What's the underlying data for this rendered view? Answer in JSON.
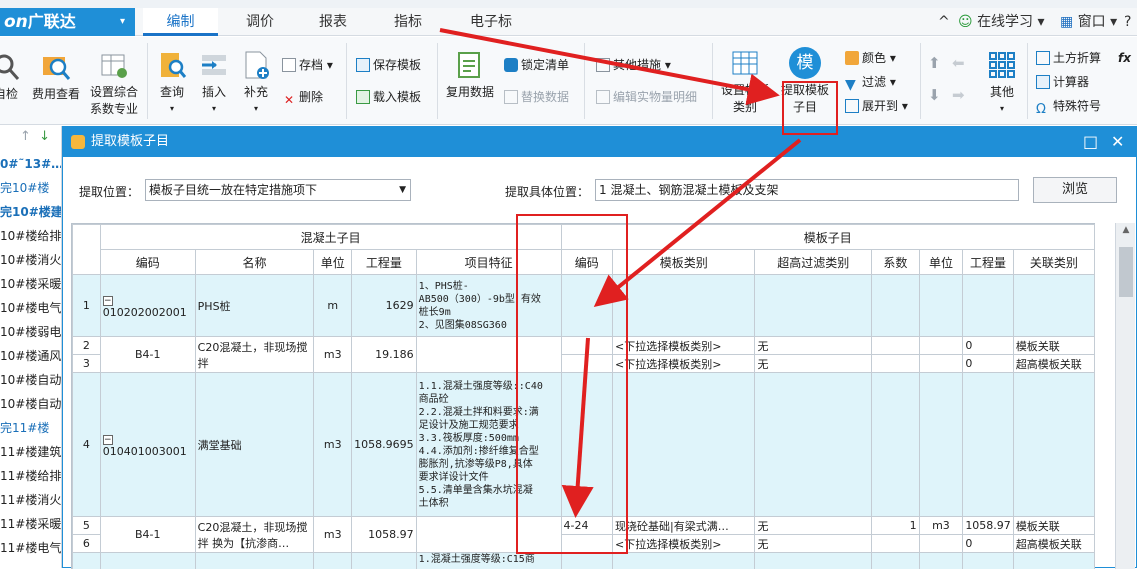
{
  "menu": {
    "logo_main": "on",
    "logo_cn": "广联达",
    "logo_dropdown": "▾",
    "tabs": [
      "编制",
      "调价",
      "报表",
      "指标",
      "电子标"
    ],
    "right": {
      "collapse": "^",
      "online": "在线学习",
      "window": "窗口",
      "help": "?"
    }
  },
  "ribbon": {
    "b_check": "自检",
    "b_fee": "费用查看",
    "b_set_unit": "设置综合",
    "b_set_unit2": "系数专业",
    "b_query": "查询",
    "b_insert": "插入",
    "b_supplement": "补充",
    "s_save": "存档",
    "s_delete": "删除",
    "s_save_tpl": "保存模板",
    "s_load_tpl": "载入模板",
    "b_reuse": "复用数据",
    "s_lock": "锁定清单",
    "s_replace": "替换数据",
    "s_other": "其他措施",
    "s_edit_detail": "编辑实物量明细",
    "b_set_tpl": "设置模板",
    "b_set_tpl2": "类别",
    "b_extract": "提取模板",
    "b_extract2": "子目",
    "extract_icon_char": "模",
    "s_color": "颜色",
    "s_filter": "过滤",
    "s_expand": "展开到",
    "b_other": "其他",
    "s_calc_up": "土方折算",
    "s_calculator": "计算器",
    "s_special": "特殊符号",
    "s_fx": "fx"
  },
  "sidebar": {
    "nav_up": "↑",
    "nav_down": "↓",
    "items": [
      "0#˜13#…",
      "完10#楼",
      "完10#楼建·",
      "10#楼给排",
      "10#楼消火",
      "10#楼采暖",
      "10#楼电气",
      "10#楼弱电",
      "10#楼通风",
      "10#楼自动",
      "10#楼自动",
      "完11#楼",
      "11#楼建筑",
      "11#楼给排",
      "11#楼消火",
      "11#楼采暖",
      "11#楼电气"
    ]
  },
  "dialog": {
    "title": "提取模板子目",
    "maximize": "□",
    "close": "✕",
    "pos_label": "提取位置：",
    "pos_value": "模板子目统一放在特定措施项下",
    "detail_label": "提取具体位置：",
    "detail_value": "1 混凝土、钢筋混凝土模板及支架",
    "browse": "浏览",
    "group_concrete": "混凝土子目",
    "group_template": "模板子目",
    "cols": [
      "编码",
      "名称",
      "单位",
      "工程量",
      "项目特征",
      "编码",
      "模板类别",
      "超高过滤类别",
      "系数",
      "单位",
      "工程量",
      "关联类别"
    ],
    "rows": [
      {
        "no": "1",
        "code": "010202002001",
        "name": "PHS桩",
        "unit": "m",
        "qty": "1629",
        "feat": [
          "1、PHS桩-",
          "AB500（300）-9b型  有效",
          "桩长9m",
          "2、见图集08SG360"
        ]
      },
      {
        "no": "2",
        "tcat": "<下拉选择模板类别>",
        "tfilter": "无",
        "tqty": "0",
        "tlink": "模板关联"
      },
      {
        "no": "3",
        "tcat": "<下拉选择模板类别>",
        "tfilter": "无",
        "tqty": "0",
        "tlink": "超高模板关联"
      },
      {
        "no": "4",
        "code": "010401003001",
        "name": "满堂基础",
        "unit": "m3",
        "qty": "1058.9695",
        "feat": [
          "1.1.混凝土强度等级::C40",
          "商品砼",
          "2.2.混凝土拌和料要求:满",
          "足设计及施工规范要求",
          "3.3.筏板厚度:500mm",
          "4.4.添加剂:掺纤维复合型",
          "膨胀剂,抗渗等级P8,具体",
          "要求详设计文件",
          "5.5.清单量含集水坑混凝",
          "土体积"
        ]
      },
      {
        "no": "5",
        "tcode": "4-24",
        "tcat": "现浇砼基础|有梁式满…",
        "tfilter": "无",
        "tcoef": "1",
        "tunit": "m3",
        "tqty": "1058.97",
        "tlink": "模板关联"
      },
      {
        "no": "6",
        "tcat": "<下拉选择模板类别>",
        "tfilter": "无",
        "tqty": "0",
        "tlink": "超高模板关联"
      }
    ],
    "sub1": {
      "code": "B4-1",
      "name": "C20混凝土，非现场搅拌",
      "unit": "m3",
      "qty": "19.186"
    },
    "sub2": {
      "code": "B4-1",
      "name": "C20混凝土，非现场搅拌  换为【抗渗商…",
      "unit": "m3",
      "qty": "1058.97"
    },
    "row7_feat": "1.混凝土强度等级:C15商"
  },
  "colors": {
    "accent": "#1f8fd7",
    "highlight_row": "#dff4fa",
    "annotation": "#e02020"
  }
}
